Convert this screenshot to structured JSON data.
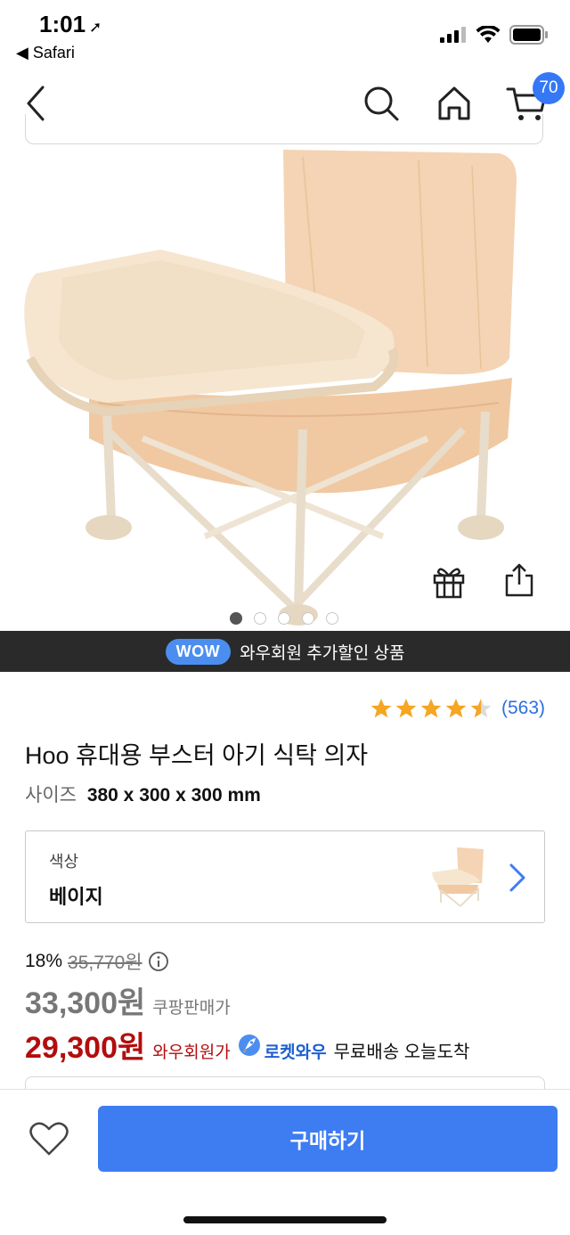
{
  "status_bar": {
    "time": "1:01",
    "back_app": "◀ Safari"
  },
  "nav": {
    "cart_count": "70",
    "icons": [
      "back-chevron-icon",
      "search-icon",
      "home-icon",
      "cart-icon"
    ]
  },
  "hero": {
    "image_total": 5,
    "image_current": 1
  },
  "wow_banner": {
    "pill": "WOW",
    "text": "와우회원 추가할인 상품"
  },
  "rating": {
    "stars": 4.5,
    "max": 5,
    "review_count": "(563)",
    "star_color": "#f5a623"
  },
  "product": {
    "title": "Hoo 휴대용 부스터 아기 식탁 의자",
    "size_label": "사이즈",
    "size_value": "380 x 300 x 300 mm"
  },
  "option": {
    "label": "색상",
    "value": "베이지"
  },
  "price": {
    "discount": "18%",
    "original": "35,770원",
    "sale_price": "33,300원",
    "sale_label": "쿠팡판매가",
    "wow_price": "29,300원",
    "wow_label": "와우회원가",
    "rocket_text": "로켓와우",
    "delivery": "무료배송 오늘도착"
  },
  "bottom": {
    "buy_label": "구매하기"
  },
  "colors": {
    "accent_blue": "#3e7cf2",
    "wow_red": "#b30d0d",
    "banner_bg": "#2a2a2a"
  }
}
